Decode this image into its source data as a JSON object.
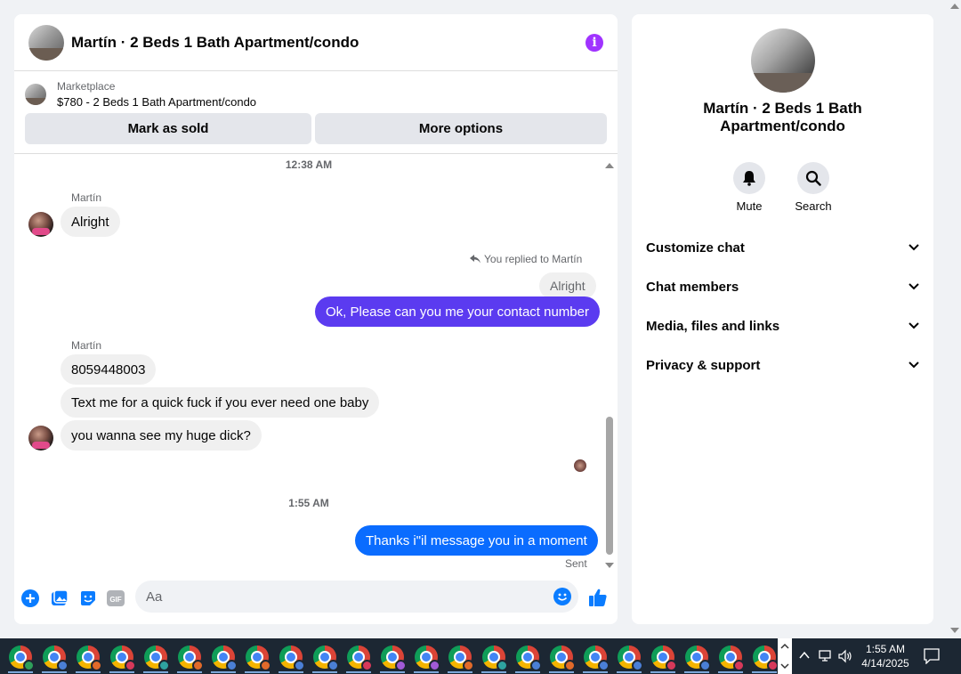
{
  "chat": {
    "title": "Martín · 2 Beds 1 Bath Apartment/condo",
    "listing": {
      "category": "Marketplace",
      "item": "$780 - 2 Beds 1 Bath Apartment/condo",
      "mark_sold": "Mark as sold",
      "more_options": "More options"
    },
    "timestamp1": "12:38 AM",
    "sender1": "Martín",
    "msg_alright": "Alright",
    "reply_note": "You replied to Martín",
    "quoted_text": "Alright",
    "msg_contact": "Ok, Please can you me your contact number",
    "sender2": "Martín",
    "msg_number": "8059448003",
    "msg_text_me": "Text me for a quick fuck if you ever need one baby",
    "msg_wanna_see": "you wanna see my huge dick?",
    "timestamp2": "1:55 AM",
    "msg_thanks": "Thanks i\"il message you in a moment",
    "sent_status": "Sent",
    "composer_placeholder": "Aa"
  },
  "details": {
    "name": "Martín · 2 Beds 1 Bath Apartment/condo",
    "mute_label": "Mute",
    "search_label": "Search",
    "sections": [
      "Customize chat",
      "Chat members",
      "Media, files and links",
      "Privacy & support"
    ]
  },
  "taskbar": {
    "time": "1:55 AM",
    "date": "4/14/2025",
    "app_count": 23
  },
  "colors": {
    "purple_bubble": "#5b3bf0",
    "blue_bubble": "#0a6cff",
    "accent": "#0a7cff",
    "info_icon": "#a033ff"
  }
}
